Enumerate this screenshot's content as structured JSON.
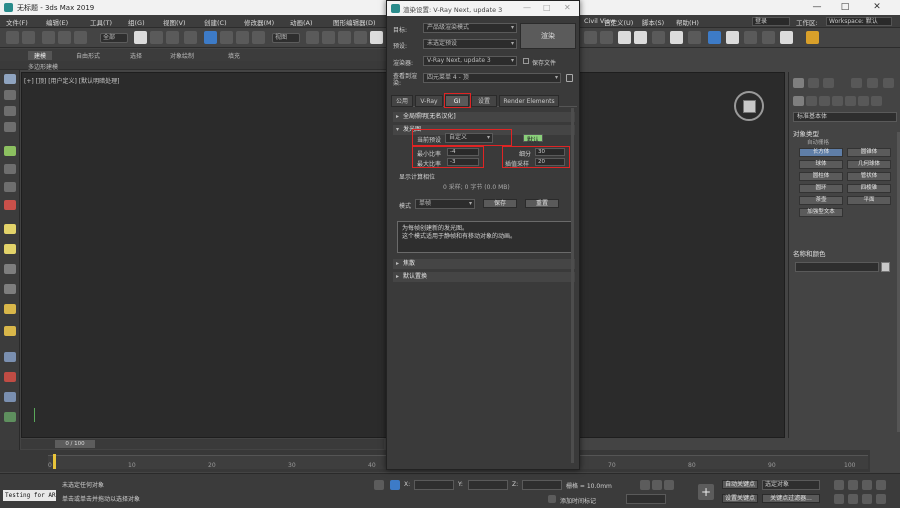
{
  "app": {
    "title": "无标题 - 3ds Max 2019",
    "controls": {
      "minimize": "—",
      "maximize": "□",
      "close": "✕"
    }
  },
  "menubar": {
    "items": [
      "文件(F)",
      "编辑(E)",
      "工具(T)",
      "组(G)",
      "视图(V)",
      "创建(C)",
      "修改器(M)",
      "动画(A)",
      "图形编辑器(D)",
      "渲染(R)",
      "Civil View",
      "自定义(U)",
      "脚本(S)",
      "Interactive",
      "内容",
      "帮助(H)"
    ],
    "user_field": "登录",
    "workspace_label": "工作区:",
    "workspace_value": "Workspace: 默认"
  },
  "toolbar": {
    "selection_filter": "全部",
    "view_dropdown": "视图"
  },
  "ribbon": {
    "tabs": [
      "建模",
      "自由形式",
      "选择",
      "对象绘制",
      "填充"
    ],
    "sub_label": "多边形建模"
  },
  "viewport": {
    "label": "[+] [顶] [用户定义] [默认明暗处理]"
  },
  "command_panel": {
    "dropdown_value": "标准基本体",
    "rollout_object_type": "对象类型",
    "auto_grid": "自动栅格",
    "buttons": [
      {
        "label": "长方体",
        "active": true
      },
      {
        "label": "圆锥体",
        "active": false
      },
      {
        "label": "球体",
        "active": false
      },
      {
        "label": "几何球体",
        "active": false
      },
      {
        "label": "圆柱体",
        "active": false
      },
      {
        "label": "管状体",
        "active": false
      },
      {
        "label": "圆环",
        "active": false
      },
      {
        "label": "四棱锥",
        "active": false
      },
      {
        "label": "茶壶",
        "active": false
      },
      {
        "label": "平面",
        "active": false
      },
      {
        "label": "加强型文本",
        "active": false
      }
    ],
    "rollout_name_color": "名称和颜色"
  },
  "render_dialog": {
    "title": "渲染设置: V-Ray Next, update 3",
    "target_label": "目标:",
    "target_value": "产品级渲染模式",
    "preset_label": "预设:",
    "preset_value": "未选定预设",
    "renderer_label": "渲染器:",
    "renderer_value": "V-Ray Next, update 3",
    "save_file": "保存文件",
    "view_label": "查看到渲染:",
    "view_value": "四元菜单 4 - 顶",
    "render_button": "渲染",
    "tabs": [
      {
        "label": "公用",
        "active": false
      },
      {
        "label": "V-Ray",
        "active": false
      },
      {
        "label": "GI",
        "active": true
      },
      {
        "label": "设置",
        "active": false
      },
      {
        "label": "Render Elements",
        "active": false
      }
    ],
    "rollout_gi": "全局照明[无名汉化]",
    "rollout_irradiance": "发光图",
    "current_preset_label": "当前预设",
    "current_preset_value": "自定义",
    "mode_chip": "默认",
    "min_rate_label": "最小比率",
    "min_rate_value": "-4",
    "max_rate_label": "最大比率",
    "max_rate_value": "-3",
    "subdivs_label": "细分",
    "subdivs_value": "30",
    "interp_label": "插值采样",
    "interp_value": "20",
    "show_calc_label": "显示计算相位",
    "stats_text": "0 采样; 0 字节 (0.0 MB)",
    "mode_label": "模式",
    "mode_value": "单帧",
    "save_btn": "保存",
    "reset_btn": "重置",
    "info_text": "为每帧创建新的发光图。\n这个模式适用于静帧和有移动对象的动画。",
    "rollout_caustics": "焦散",
    "rollout_defaults": "默认置换"
  },
  "timeline": {
    "frame_slider": "0 / 100",
    "ticks": [
      "0",
      "10",
      "20",
      "30",
      "40",
      "50",
      "60",
      "70",
      "80",
      "90",
      "100"
    ]
  },
  "statusbar": {
    "maxscript": "Testing for AR",
    "line1": "未选定任何对象",
    "line2": "单击或单击并拖动以选择对象",
    "x_label": "X:",
    "y_label": "Y:",
    "z_label": "Z:",
    "grid_label": "栅格 = 10.0mm",
    "add_time_tag": "添加时间标记",
    "auto_key": "自动关键点",
    "set_key": "设置关键点",
    "selected_object": "选定对象",
    "key_filters": "关键点过滤器..."
  }
}
